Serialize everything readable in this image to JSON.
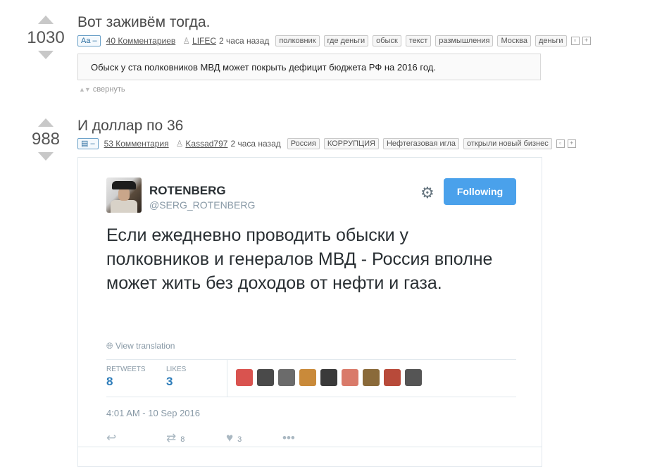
{
  "posts": [
    {
      "score": "1030",
      "title": "Вот заживём тогда.",
      "type_badge": "Aa –",
      "comments": "40 Комментариев",
      "author": "LIFEC",
      "time": "2 часа назад",
      "tags": [
        "полковник",
        "где деньги",
        "обыск",
        "текст",
        "размышления",
        "Москва",
        "деньги"
      ],
      "text": "Обыск у ста полковников МВД может покрыть дефицит бюджета РФ на 2016 год.",
      "collapse_label": "свернуть"
    },
    {
      "score": "988",
      "title": "И доллар по 36",
      "type_badge": "▤ –",
      "comments": "53 Комментария",
      "author": "Kassad797",
      "time": "2 часа назад",
      "tags": [
        "Россия",
        "КОРРУПЦИЯ",
        "Нефтегазовая игла",
        "открыли новый бизнес"
      ]
    }
  ],
  "tweet": {
    "name": "ROTENBERG",
    "handle": "@SERG_ROTENBERG",
    "follow_label": "Following",
    "text": "Если ежедневно проводить обыски у полковников и генералов МВД - Россия вполне может жить без доходов от нефти и газа.",
    "translate_label": "View translation",
    "retweets_label": "RETWEETS",
    "retweets": "8",
    "likes_label": "LIKES",
    "likes": "3",
    "timestamp": "4:01 AM - 10 Sep 2016",
    "action_retweets": "8",
    "action_likes": "3",
    "liker_colors": [
      "#d9534f",
      "#4a4a4a",
      "#6b6b6b",
      "#c98a3a",
      "#3a3a3a",
      "#d97a6a",
      "#8a6a3a",
      "#b84a3a",
      "#555555"
    ]
  },
  "colors": {
    "follow_button": "#4aa1eb",
    "stat_value": "#2b7bb9"
  }
}
